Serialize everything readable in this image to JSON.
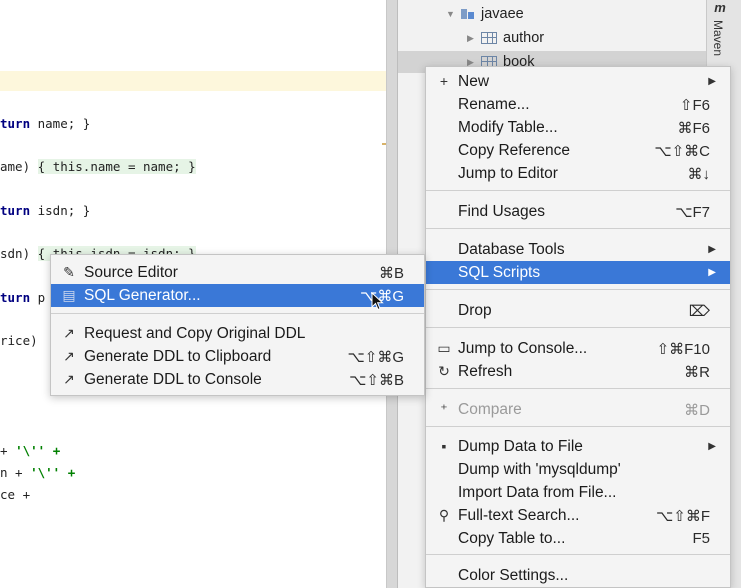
{
  "editor": {
    "lines": [
      {
        "pre": "",
        "kw": "turn",
        "rest": " name; }",
        "brace": false
      },
      {
        "pre": "ame) ",
        "kw": "",
        "rest": "{ this.name = name; }",
        "brace": true
      },
      {
        "pre": "",
        "kw": "turn",
        "rest": " isdn; }",
        "brace": false
      },
      {
        "pre": "sdn) ",
        "kw": "",
        "rest": "{ this.isdn = isdn; }",
        "brace": true
      },
      {
        "pre": "",
        "kw": "turn",
        "rest": " p",
        "brace": false
      },
      {
        "pre": "rice) ",
        "kw": "",
        "rest": "",
        "brace": false
      },
      {
        "pre": "+ ",
        "kw": "",
        "rest": "'\\'' +",
        "brace": false
      },
      {
        "pre": "n + ",
        "kw": "",
        "rest": "'\\'' +",
        "brace": false
      },
      {
        "pre": "ce +",
        "kw": "",
        "rest": "",
        "brace": false
      }
    ]
  },
  "tree": {
    "schema": "javaee",
    "tables": [
      "author",
      "book"
    ]
  },
  "maven": {
    "letter": "m",
    "label": "Maven"
  },
  "context_menu": {
    "items": [
      {
        "icon": "+",
        "label": "New",
        "shortcut": "",
        "submenu": true
      },
      {
        "icon": "",
        "label": "Rename...",
        "shortcut": "⇧F6"
      },
      {
        "icon": "",
        "label": "Modify Table...",
        "shortcut": "⌘F6"
      },
      {
        "icon": "",
        "label": "Copy Reference",
        "shortcut": "⌥⇧⌘C"
      },
      {
        "icon": "",
        "label": "Jump to Editor",
        "shortcut": "⌘↓"
      },
      {
        "icon": "",
        "label": "Find Usages",
        "shortcut": "⌥F7"
      },
      {
        "icon": "",
        "label": "Database Tools",
        "shortcut": "",
        "submenu": true
      },
      {
        "icon": "",
        "label": "SQL Scripts",
        "shortcut": "",
        "submenu": true,
        "selected": true
      },
      {
        "icon": "",
        "label": "Drop",
        "shortcut": "⌦"
      },
      {
        "icon": "▭",
        "label": "Jump to Console...",
        "shortcut": "⇧⌘F10"
      },
      {
        "icon": "↻",
        "label": "Refresh",
        "shortcut": "⌘R"
      },
      {
        "icon": "⁺",
        "label": "Compare",
        "shortcut": "⌘D",
        "disabled": true
      },
      {
        "icon": "▪",
        "label": "Dump Data to File",
        "shortcut": "",
        "submenu": true
      },
      {
        "icon": "",
        "label": "Dump with 'mysqldump'",
        "shortcut": ""
      },
      {
        "icon": "",
        "label": "Import Data from File...",
        "shortcut": ""
      },
      {
        "icon": "⚲",
        "label": "Full-text Search...",
        "shortcut": "⌥⇧⌘F"
      },
      {
        "icon": "",
        "label": "Copy Table to...",
        "shortcut": "F5"
      },
      {
        "icon": "",
        "label": "Color Settings...",
        "shortcut": ""
      }
    ]
  },
  "submenu": {
    "items": [
      {
        "icon": "✎",
        "label": "Source Editor",
        "shortcut": "⌘B"
      },
      {
        "icon": "▤",
        "label": "SQL Generator...",
        "shortcut": "⌥⌘G",
        "selected": true
      },
      {
        "icon": "↗",
        "label": "Request and Copy Original DDL",
        "shortcut": ""
      },
      {
        "icon": "↗",
        "label": "Generate DDL to Clipboard",
        "shortcut": "⌥⇧⌘G"
      },
      {
        "icon": "↗",
        "label": "Generate DDL to Console",
        "shortcut": "⌥⇧⌘B"
      }
    ]
  },
  "colors": {
    "selection": "#3a78d7",
    "menu_bg": "#f4f4f4",
    "keyword": "#000080"
  }
}
